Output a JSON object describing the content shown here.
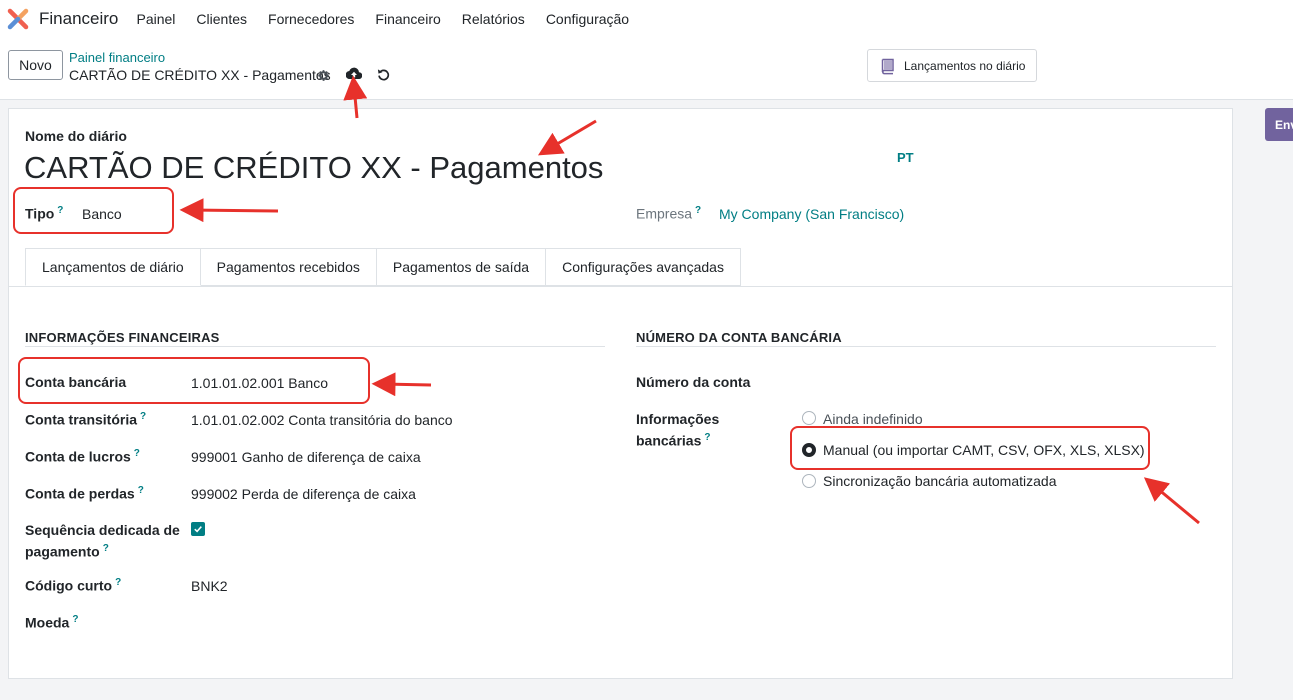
{
  "app": {
    "name": "Financeiro"
  },
  "menu": [
    "Painel",
    "Clientes",
    "Fornecedores",
    "Financeiro",
    "Relatórios",
    "Configuração"
  ],
  "control": {
    "new_label": "Novo",
    "breadcrumb_parent": "Painel financeiro",
    "breadcrumb_current": "CARTÃO DE CRÉDITO XX - Pagamentos",
    "journal_entries_button": "Lançamentos no diário",
    "send_button": "Env"
  },
  "form": {
    "journal_name_label": "Nome do diário",
    "journal_name": "CARTÃO DE CRÉDITO XX - Pagamentos",
    "language_badge": "PT",
    "type_label": "Tipo",
    "type_value": "Banco",
    "company_label": "Empresa",
    "company_value": "My Company (San Francisco)",
    "help_mark": "?"
  },
  "tabs": [
    "Lançamentos de diário",
    "Pagamentos recebidos",
    "Pagamentos de saída",
    "Configurações avançadas"
  ],
  "financial": {
    "title": "INFORMAÇÕES FINANCEIRAS",
    "bank_account_label": "Conta bancária",
    "bank_account_value": "1.01.01.02.001 Banco",
    "transit_label": "Conta transitória",
    "transit_value": "1.01.01.02.002 Conta transitória do banco",
    "profit_label": "Conta de lucros",
    "profit_value": "999001 Ganho de diferença de caixa",
    "loss_label": "Conta de perdas",
    "loss_value": "999002 Perda de diferença de caixa",
    "dedicated_seq_label_1": "Sequência dedicada de",
    "dedicated_seq_label_2": "pagamento",
    "dedicated_seq_checked": true,
    "short_code_label": "Código curto",
    "short_code_value": "BNK2",
    "currency_label": "Moeda"
  },
  "bank": {
    "title": "NÚMERO DA CONTA BANCÁRIA",
    "account_number_label": "Número da conta",
    "bank_info_label_1": "Informações",
    "bank_info_label_2": "bancárias",
    "options": [
      "Ainda indefinido",
      "Manual (ou importar CAMT, CSV, OFX, XLS, XLSX)",
      "Sincronização bancária automatizada"
    ],
    "selected_option": "Manual (ou importar CAMT, CSV, OFX, XLS, XLSX)"
  },
  "colors": {
    "accent": "#017e84",
    "brand": "#71639e",
    "annotation": "#e7312b"
  },
  "icons": [
    "odoo-logo-icon",
    "gear-icon",
    "cloud-upload-icon",
    "undo-icon",
    "book-icon",
    "checkmark-icon"
  ]
}
